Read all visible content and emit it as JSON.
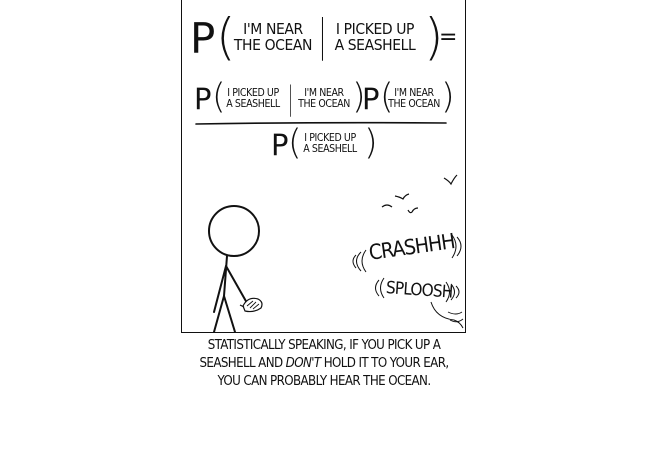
{
  "formula": {
    "p": "P",
    "equals": "=",
    "divider": "|",
    "lhs": {
      "event_a": [
        "I'M NEAR",
        "THE OCEAN"
      ],
      "event_b": [
        "I PICKED UP",
        "A SEASHELL"
      ]
    },
    "numerator": {
      "term1_a": [
        "I PICKED UP",
        "A SEASHELL"
      ],
      "term1_b": [
        "I'M NEAR",
        "THE OCEAN"
      ],
      "term2": [
        "I'M NEAR",
        "THE OCEAN"
      ]
    },
    "denominator": {
      "term": [
        "I PICKED UP",
        "A SEASHELL"
      ]
    }
  },
  "sound_effects": {
    "crash": "CRASHHH",
    "sploosh": "SPLOOSH"
  },
  "caption": {
    "line1": "STATISTICALLY SPEAKING, IF YOU PICK UP A",
    "line2_pre": "SEASHELL AND ",
    "line2_em": "DON'T",
    "line2_post": " HOLD IT TO YOUR EAR,",
    "line3": "YOU CAN PROBABLY HEAR THE OCEAN."
  }
}
